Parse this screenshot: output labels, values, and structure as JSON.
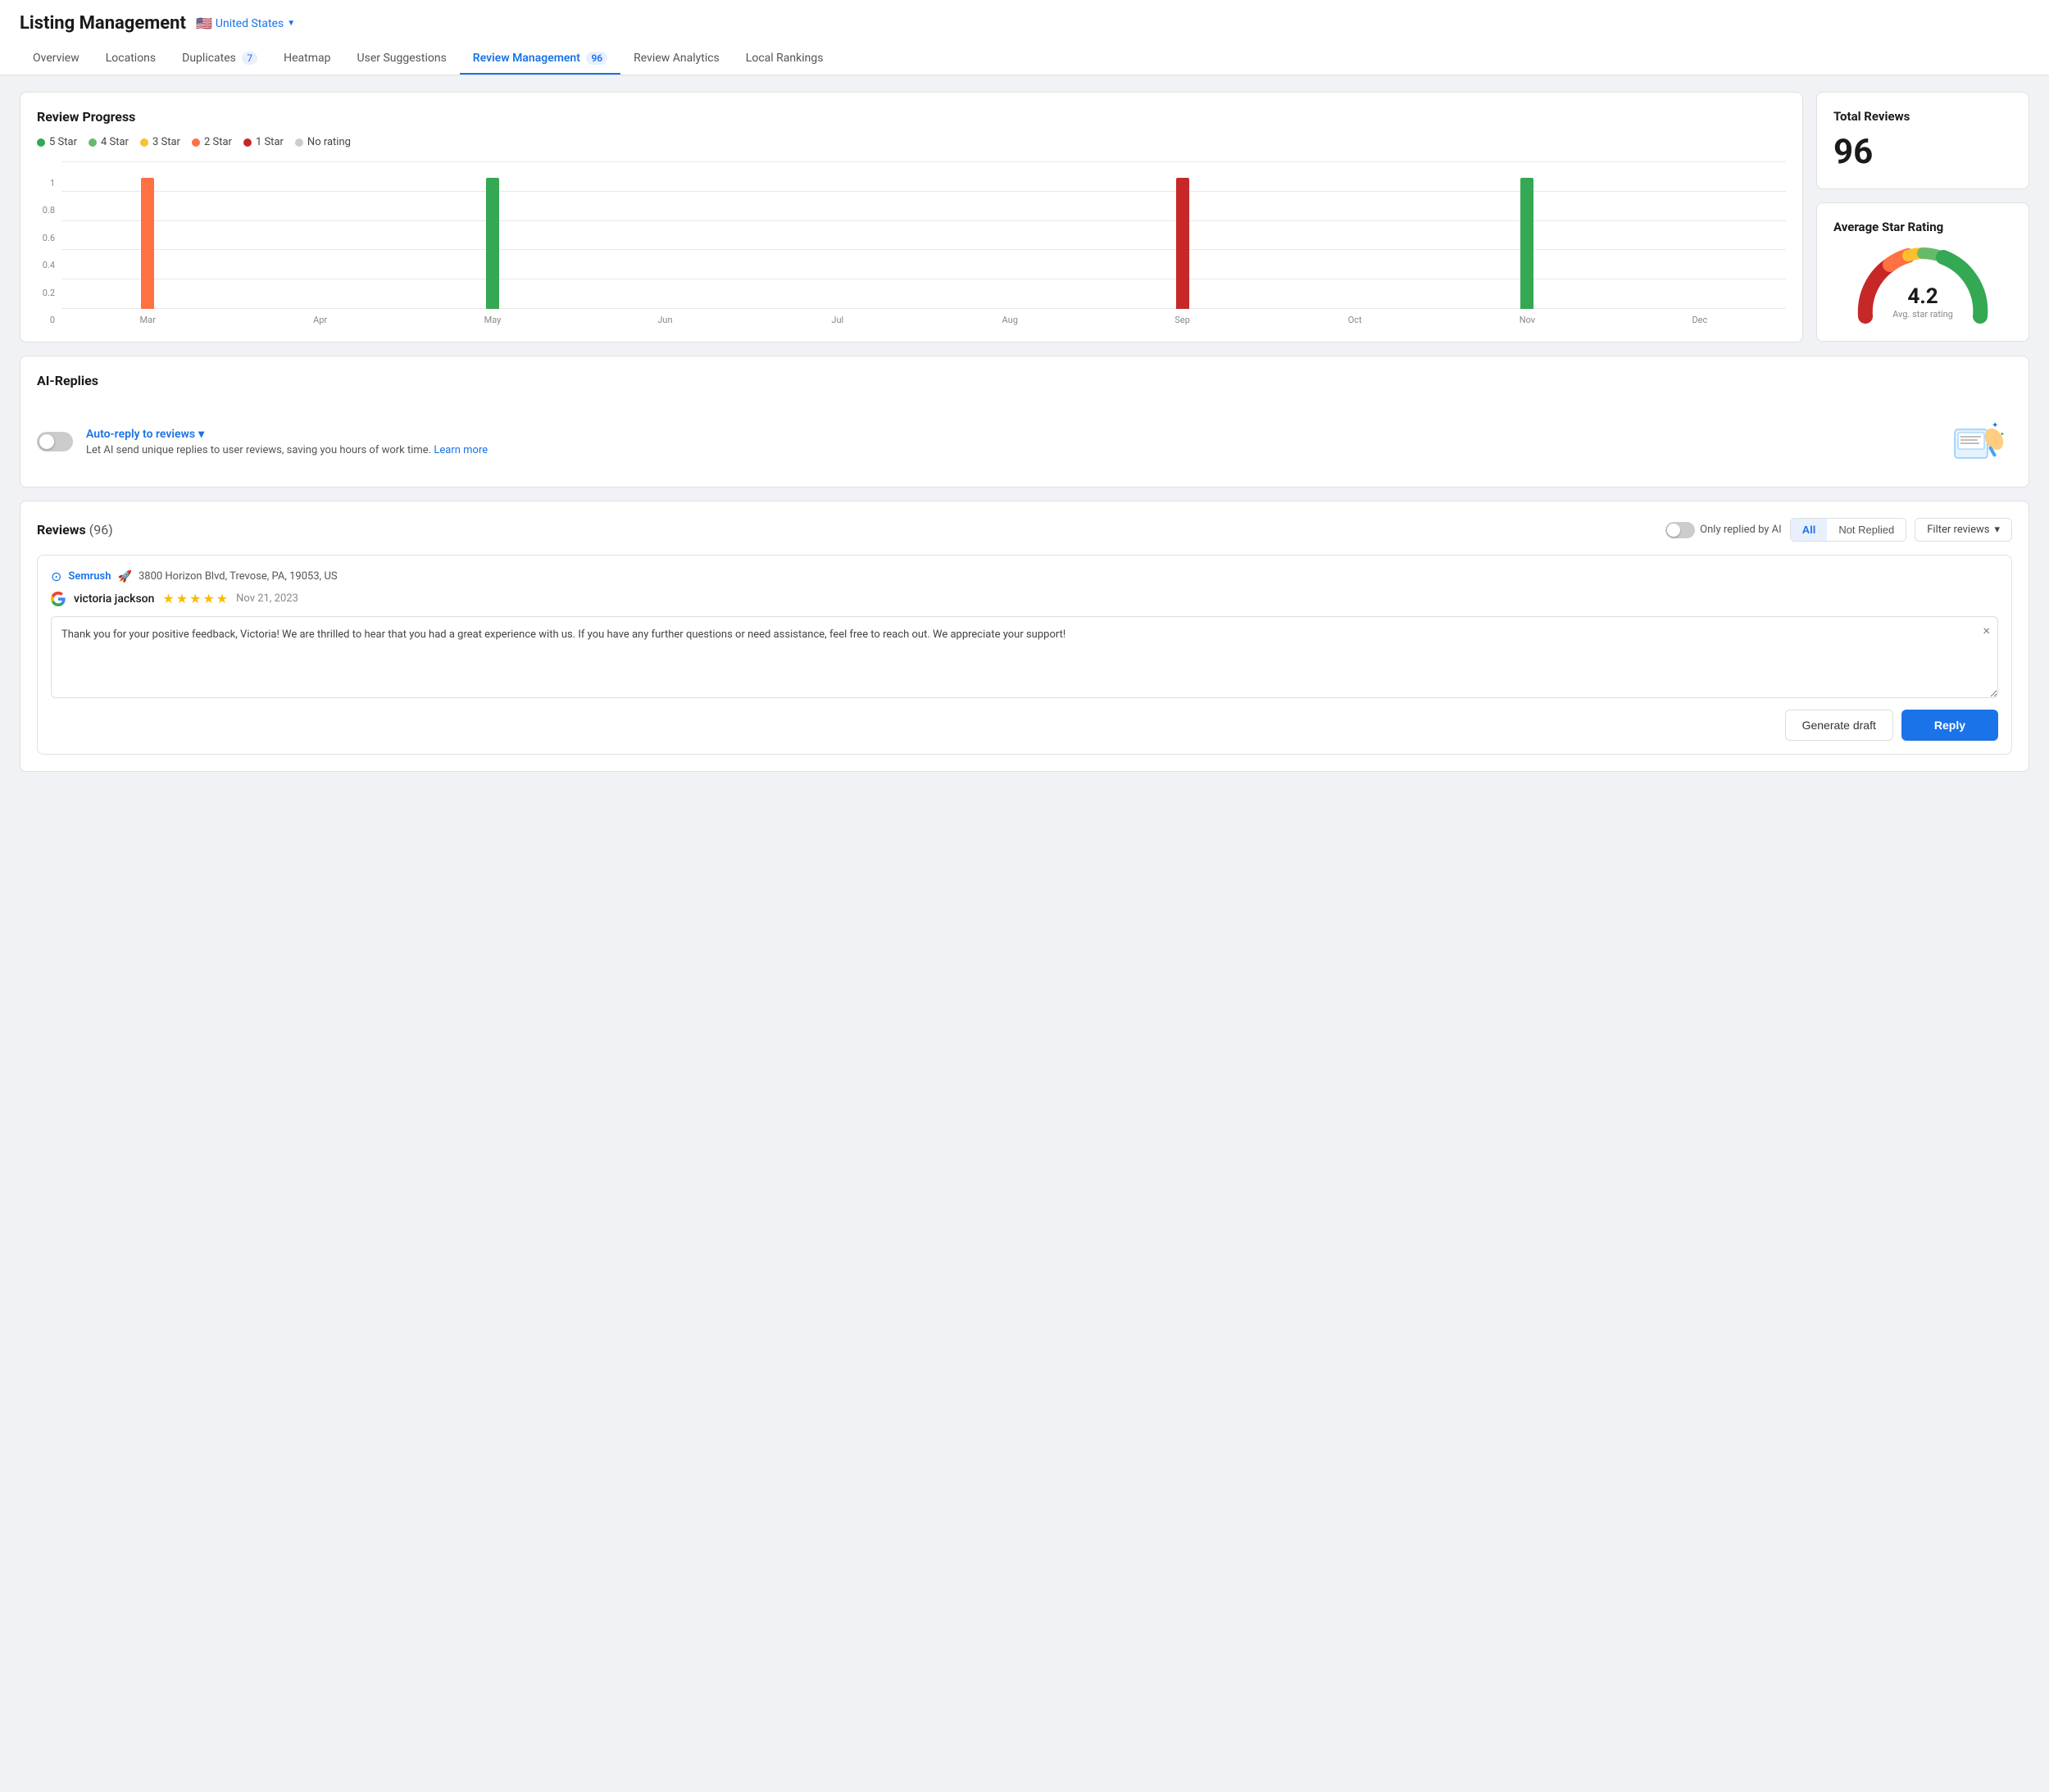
{
  "header": {
    "title": "Listing Management",
    "country": "United States",
    "country_flag": "🇺🇸"
  },
  "nav": {
    "tabs": [
      {
        "id": "overview",
        "label": "Overview",
        "badge": null,
        "active": false
      },
      {
        "id": "locations",
        "label": "Locations",
        "badge": null,
        "active": false
      },
      {
        "id": "duplicates",
        "label": "Duplicates",
        "badge": "7",
        "active": false
      },
      {
        "id": "heatmap",
        "label": "Heatmap",
        "badge": null,
        "active": false
      },
      {
        "id": "user-suggestions",
        "label": "User Suggestions",
        "badge": null,
        "active": false
      },
      {
        "id": "review-management",
        "label": "Review Management",
        "badge": "96",
        "active": true
      },
      {
        "id": "review-analytics",
        "label": "Review Analytics",
        "badge": null,
        "active": false
      },
      {
        "id": "local-rankings",
        "label": "Local Rankings",
        "badge": null,
        "active": false
      }
    ]
  },
  "review_progress": {
    "title": "Review Progress",
    "legend": [
      {
        "label": "5 Star",
        "color": "#34a853"
      },
      {
        "label": "4 Star",
        "color": "#66bb6a"
      },
      {
        "label": "3 Star",
        "color": "#fbc02d"
      },
      {
        "label": "2 Star",
        "color": "#ff7043"
      },
      {
        "label": "1 Star",
        "color": "#c62828"
      },
      {
        "label": "No rating",
        "color": "#ccc"
      }
    ],
    "y_labels": [
      "1",
      "0.8",
      "0.6",
      "0.4",
      "0.2",
      "0"
    ],
    "months": [
      "Mar",
      "Apr",
      "May",
      "Jun",
      "Jul",
      "Aug",
      "Sep",
      "Oct",
      "Nov",
      "Dec"
    ],
    "bars": [
      {
        "month": "Mar",
        "height": 100,
        "color": "#ff7043"
      },
      {
        "month": "Apr",
        "height": 0,
        "color": "transparent"
      },
      {
        "month": "May",
        "height": 100,
        "color": "#34a853"
      },
      {
        "month": "Jun",
        "height": 0,
        "color": "transparent"
      },
      {
        "month": "Jul",
        "height": 0,
        "color": "transparent"
      },
      {
        "month": "Aug",
        "height": 0,
        "color": "transparent"
      },
      {
        "month": "Sep",
        "height": 100,
        "color": "#c62828"
      },
      {
        "month": "Oct",
        "height": 0,
        "color": "transparent"
      },
      {
        "month": "Nov",
        "height": 100,
        "color": "#34a853"
      },
      {
        "month": "Dec",
        "height": 0,
        "color": "transparent"
      }
    ]
  },
  "total_reviews": {
    "title": "Total Reviews",
    "value": "96"
  },
  "avg_star_rating": {
    "title": "Average Star Rating",
    "value": "4.2",
    "label": "Avg. star rating"
  },
  "ai_replies": {
    "title": "AI-Replies",
    "auto_reply_label": "Auto-reply to reviews",
    "description": "Let AI send unique replies to user reviews, saving you hours of work time.",
    "learn_more": "Learn more"
  },
  "reviews_section": {
    "title": "Reviews",
    "count": "(96)",
    "only_ai_label": "Only replied by AI",
    "tab_all": "All",
    "tab_not_replied": "Not Replied",
    "filter_label": "Filter reviews"
  },
  "review_item": {
    "location_name": "Semrush",
    "location_emoji": "🚀",
    "location_address": "3800 Horizon Blvd, Trevose, PA, 19053, US",
    "reviewer": "victoria jackson",
    "stars": 5,
    "date": "Nov 21, 2023",
    "reply_text": "Thank you for your positive feedback, Victoria! We are thrilled to hear that you had a great experience with us. If you have any further questions or need assistance, feel free to reach out. We appreciate your support!",
    "btn_generate": "Generate draft",
    "btn_reply": "Reply"
  }
}
